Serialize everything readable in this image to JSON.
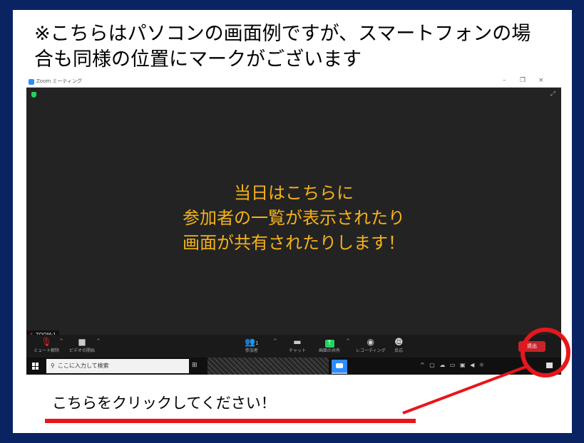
{
  "heading": {
    "line1": "※こちらはパソコンの画面例ですが、スマートフォンの場",
    "line2": "合も同様の位置にマークがございます"
  },
  "window": {
    "title": "Zoom ミーティング",
    "minimize": "–",
    "restore": "❐",
    "close": "×"
  },
  "stage": {
    "line1": "当日はこちらに",
    "line2": "参加者の一覧が表示されたり",
    "line3": "画面が共有されたりします！",
    "text_color": "#f5b21a"
  },
  "name_tag": "ZOOM-1",
  "controls": {
    "mute": "ミュート解除",
    "video": "ビデオの開始",
    "participants": "参加者",
    "participants_count": "1",
    "chat": "チャット",
    "share": "画面の共有",
    "record": "レコーディング",
    "reactions": "反応",
    "leave": "退出",
    "leave_color": "#c8232b"
  },
  "taskbar": {
    "search_placeholder": "ここに入力して検索"
  },
  "callout": {
    "text": "こちらをクリックしてください！",
    "accent": "#e8161b"
  }
}
